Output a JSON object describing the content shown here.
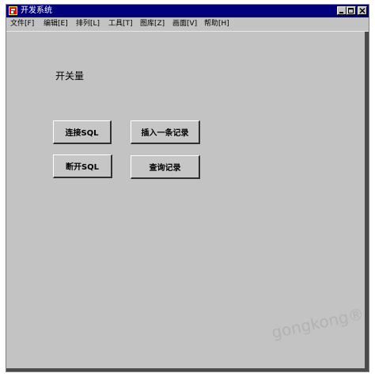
{
  "window": {
    "title": "开发系统"
  },
  "menu": {
    "items": [
      {
        "label": "文件[F]"
      },
      {
        "label": "编辑[E]"
      },
      {
        "label": "排列[L]"
      },
      {
        "label": "工具[T]"
      },
      {
        "label": "图库[Z]"
      },
      {
        "label": "画面[V]"
      },
      {
        "label": "帮助[H]"
      }
    ]
  },
  "content": {
    "label": "开关量",
    "buttons": {
      "connect": "连接SQL",
      "insert": "插入一条记录",
      "disconnect": "断开SQL",
      "query": "查询记录"
    }
  },
  "watermark": "gongkong®",
  "colors": {
    "titlebar": "#00007b",
    "background": "#c3c3c3"
  }
}
